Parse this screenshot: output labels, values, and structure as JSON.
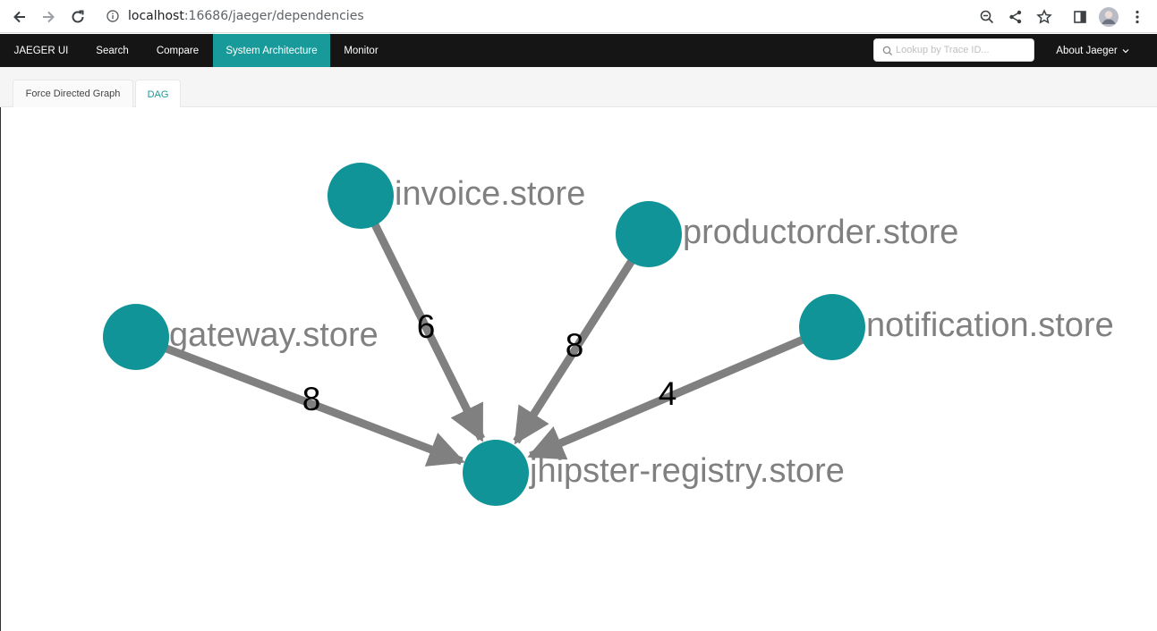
{
  "browser": {
    "url_host": "localhost",
    "url_path": ":16686/jaeger/dependencies",
    "icons": [
      "back-arrow-icon",
      "forward-arrow-icon",
      "reload-icon",
      "info-icon",
      "zoom-icon",
      "share-icon",
      "star-icon",
      "side-panel-icon",
      "profile-avatar",
      "menu-dots-icon"
    ]
  },
  "topnav": {
    "brand": "JAEGER UI",
    "items": [
      "Search",
      "Compare",
      "System Architecture",
      "Monitor"
    ],
    "active": "System Architecture",
    "search_placeholder": "Lookup by Trace ID...",
    "about": "About Jaeger"
  },
  "tabs": {
    "items": [
      "Force Directed Graph",
      "DAG"
    ],
    "active": "DAG"
  },
  "graph": {
    "node_color": "#119497",
    "edge_color": "#808080",
    "nodes": [
      {
        "id": "invoice",
        "label": "invoice.store"
      },
      {
        "id": "productorder",
        "label": "productorder.store"
      },
      {
        "id": "gateway",
        "label": "gateway.store"
      },
      {
        "id": "notification",
        "label": "notification.store"
      },
      {
        "id": "registry",
        "label": "jhipster-registry.store"
      }
    ],
    "edges": [
      {
        "from": "gateway",
        "to": "registry",
        "label": "8"
      },
      {
        "from": "invoice",
        "to": "registry",
        "label": "6"
      },
      {
        "from": "productorder",
        "to": "registry",
        "label": "8"
      },
      {
        "from": "notification",
        "to": "registry",
        "label": "4"
      }
    ]
  }
}
